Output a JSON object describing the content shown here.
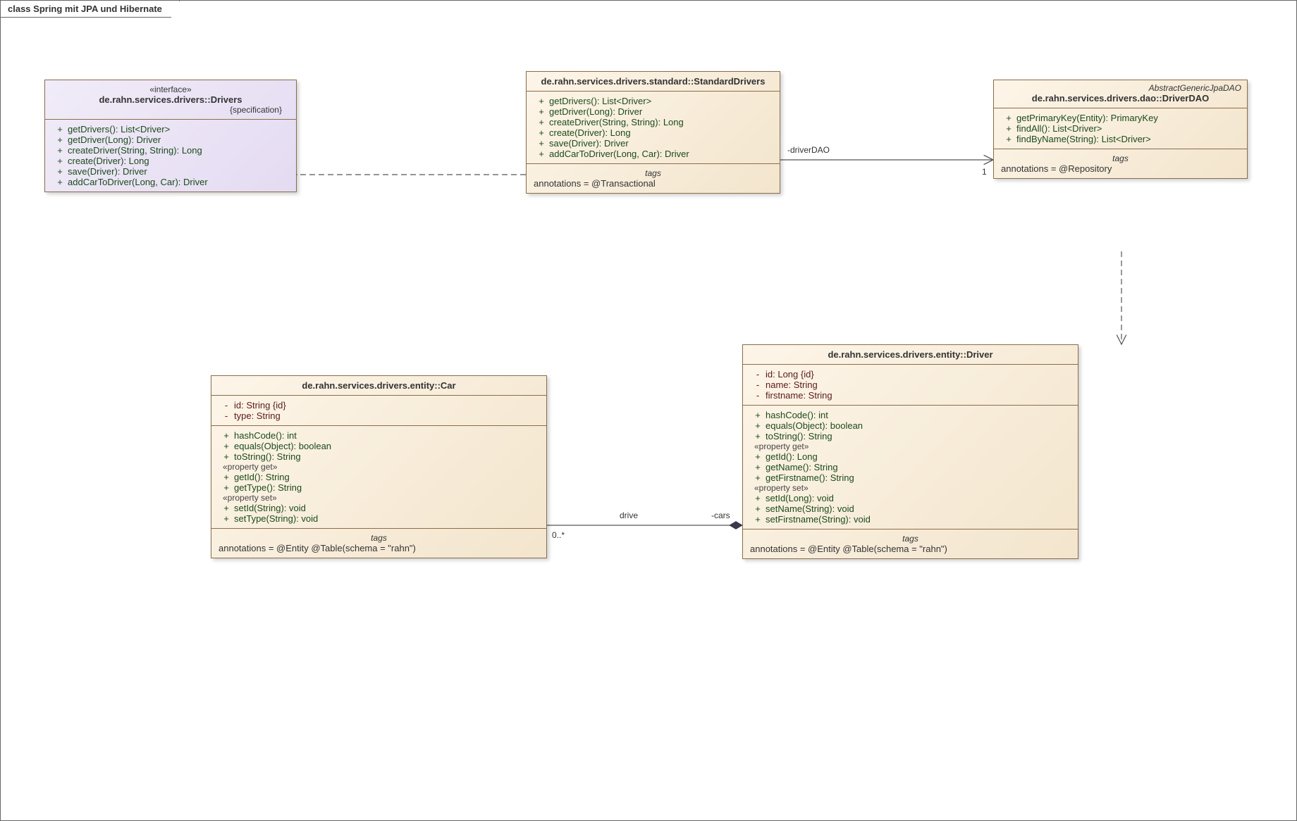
{
  "diagram": {
    "title": "class Spring mit JPA und Hibernate"
  },
  "drivers_iface": {
    "stereotype": "«interface»",
    "title": "de.rahn.services.drivers::Drivers",
    "constraint": "{specification}",
    "ops": [
      "getDrivers(): List<Driver>",
      "getDriver(Long): Driver",
      "createDriver(String, String): Long",
      "create(Driver): Long",
      "save(Driver): Driver",
      "addCarToDriver(Long, Car): Driver"
    ]
  },
  "standard_drivers": {
    "title": "de.rahn.services.drivers.standard::StandardDrivers",
    "ops": [
      "getDrivers(): List<Driver>",
      "getDriver(Long): Driver",
      "createDriver(String, String): Long",
      "create(Driver): Long",
      "save(Driver): Driver",
      "addCarToDriver(Long, Car): Driver"
    ],
    "tags_label": "tags",
    "tags": "annotations = @Transactional"
  },
  "driver_dao": {
    "parent": "AbstractGenericJpaDAO",
    "title": "de.rahn.services.drivers.dao::DriverDAO",
    "ops": [
      "getPrimaryKey(Entity): PrimaryKey",
      "findAll(): List<Driver>",
      "findByName(String): List<Driver>"
    ],
    "tags_label": "tags",
    "tags": "annotations = @Repository"
  },
  "car": {
    "title": "de.rahn.services.drivers.entity::Car",
    "attrs": [
      "id: String {id}",
      "type: String"
    ],
    "ops_main": [
      "hashCode(): int",
      "equals(Object): boolean",
      "toString(): String"
    ],
    "get_label": "«property get»",
    "ops_get": [
      "getId(): String",
      "getType(): String"
    ],
    "set_label": "«property set»",
    "ops_set": [
      "setId(String): void",
      "setType(String): void"
    ],
    "tags_label": "tags",
    "tags": "annotations = @Entity @Table(schema = \"rahn\")"
  },
  "driver": {
    "title": "de.rahn.services.drivers.entity::Driver",
    "attrs": [
      "id: Long {id}",
      "name: String",
      "firstname: String"
    ],
    "ops_main": [
      "hashCode(): int",
      "equals(Object): boolean",
      "toString(): String"
    ],
    "get_label": "«property get»",
    "ops_get": [
      "getId(): Long",
      "getName(): String",
      "getFirstname(): String"
    ],
    "set_label": "«property set»",
    "ops_set": [
      "setId(Long): void",
      "setName(String): void",
      "setFirstname(String): void"
    ],
    "tags_label": "tags",
    "tags": "annotations = @Entity @Table(schema = \"rahn\")"
  },
  "assoc": {
    "standard_to_dao": {
      "role": "-driverDAO",
      "mult": "1"
    },
    "driver_to_car": {
      "name": "drive",
      "role": "-cars",
      "mult": "0..*"
    }
  }
}
